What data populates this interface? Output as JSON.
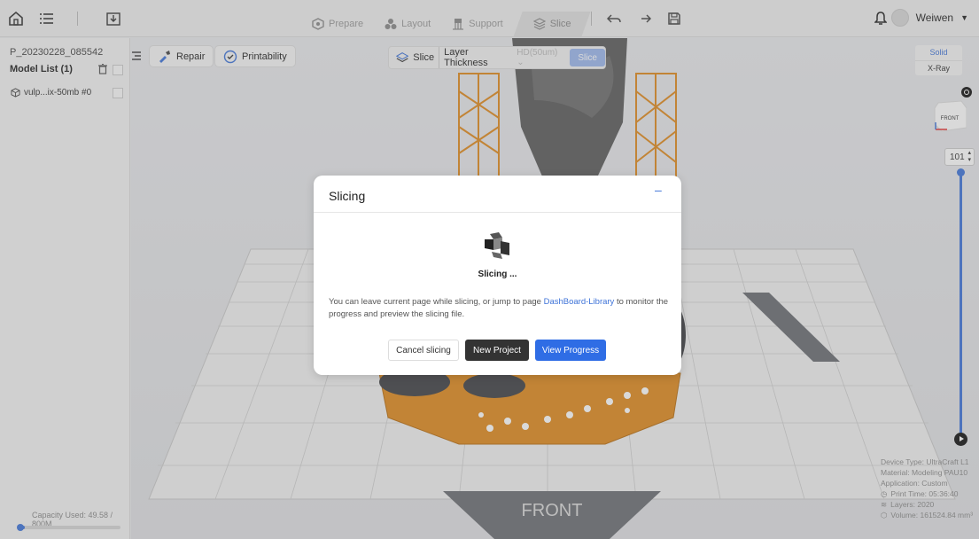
{
  "topbar": {
    "tabs": [
      {
        "label": "Prepare",
        "icon": "prepare-icon"
      },
      {
        "label": "Layout",
        "icon": "layout-icon"
      },
      {
        "label": "Support",
        "icon": "support-icon"
      },
      {
        "label": "Slice",
        "icon": "slice-icon",
        "active": true
      }
    ],
    "user_name": "Weiwen"
  },
  "left_panel": {
    "project_name": "P_20230228_085542",
    "model_list_title": "Model List (1)",
    "models": [
      {
        "name": "vulp...ix-50mb #0"
      }
    ],
    "capacity_text": "Capacity Used: 49.58 / 800M",
    "capacity_fraction": 0.06
  },
  "toolbar": {
    "repair_label": "Repair",
    "printability_label": "Printability"
  },
  "slice_bar": {
    "slice_label": "Slice",
    "layer_thickness_label": "Layer Thickness",
    "layer_thickness_value": "HD(50um)",
    "slice_button": "Slice"
  },
  "view_switch": {
    "solid": "Solid",
    "xray": "X-Ray"
  },
  "view_cube_label": "FRONT",
  "layer_value": "101",
  "floor_label": "FRONT",
  "info": {
    "device_type": "Device Type: UltraCraft L1",
    "material": "Material: Modeling PAU10",
    "application": "Application: Custom",
    "print_time": "Print Time: 05:36:40",
    "layers": "Layers: 2020",
    "volume": "Volume: 161524.84 mm³"
  },
  "dialog": {
    "title": "Slicing",
    "status": "Slicing ...",
    "message_pre": "You can leave current page while slicing, or jump to page ",
    "message_link": "DashBoard-Library",
    "message_post": " to monitor the progress and preview the slicing file.",
    "cancel_button": "Cancel slicing",
    "new_project_button": "New Project",
    "view_progress_button": "View Progress"
  },
  "colors": {
    "accent": "#2f6de5",
    "support_orange": "#e08a1e",
    "model_gray": "#5a5a5a"
  }
}
